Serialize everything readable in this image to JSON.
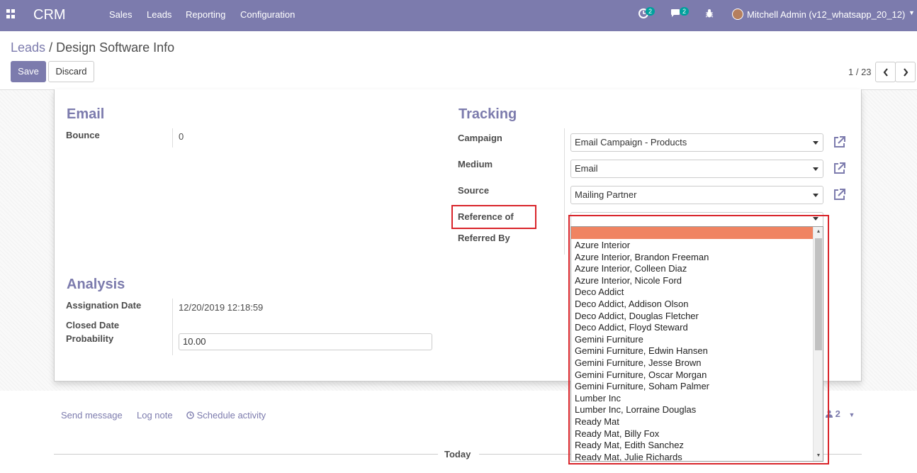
{
  "navbar": {
    "brand": "CRM",
    "menu": [
      "Sales",
      "Leads",
      "Reporting",
      "Configuration"
    ],
    "activity_count": "2",
    "message_count": "2",
    "user_name": "Mitchell Admin (v12_whatsapp_20_12)"
  },
  "breadcrumb": {
    "parent": "Leads",
    "separator": "/",
    "current": "Design Software Info"
  },
  "buttons": {
    "save": "Save",
    "discard": "Discard"
  },
  "pager": {
    "value": "1 / 23"
  },
  "email_section": {
    "title": "Email",
    "bounce_label": "Bounce",
    "bounce_value": "0"
  },
  "tracking_section": {
    "title": "Tracking",
    "campaign_label": "Campaign",
    "campaign_value": "Email Campaign - Products",
    "medium_label": "Medium",
    "medium_value": "Email",
    "source_label": "Source",
    "source_value": "Mailing Partner",
    "reference_label": "Reference of",
    "referred_by_label": "Referred By"
  },
  "analysis_section": {
    "title": "Analysis",
    "assignation_label": "Assignation Date",
    "assignation_value": "12/20/2019 12:18:59",
    "closed_label": "Closed Date",
    "probability_label": "Probability",
    "probability_value": "10.00"
  },
  "dropdown": {
    "items": [
      "Azure Interior",
      "Azure Interior, Brandon Freeman",
      "Azure Interior, Colleen Diaz",
      "Azure Interior, Nicole Ford",
      "Deco Addict",
      "Deco Addict, Addison Olson",
      "Deco Addict, Douglas Fletcher",
      "Deco Addict, Floyd Steward",
      "Gemini Furniture",
      "Gemini Furniture, Edwin Hansen",
      "Gemini Furniture, Jesse Brown",
      "Gemini Furniture, Oscar Morgan",
      "Gemini Furniture, Soham Palmer",
      "Lumber Inc",
      "Lumber Inc, Lorraine Douglas",
      "Ready Mat",
      "Ready Mat, Billy Fox",
      "Ready Mat, Edith Sanchez",
      "Ready Mat, Julie Richards"
    ]
  },
  "chatter": {
    "send_message": "Send message",
    "log_note": "Log note",
    "schedule_activity": "Schedule activity",
    "followers_count": "2",
    "today": "Today"
  },
  "colors": {
    "brand": "#7c7bad",
    "highlight": "#d9242a",
    "selected_option": "#f08361"
  }
}
